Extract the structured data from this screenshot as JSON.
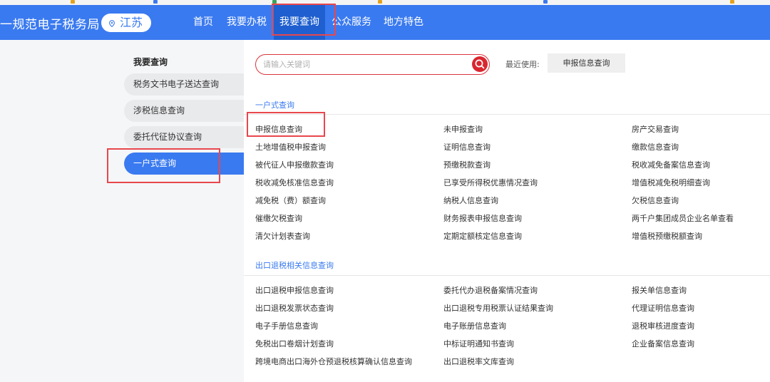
{
  "colors": {
    "primary": "#3a7af0",
    "highlight": "#e8474d",
    "search_button": "#d9262f"
  },
  "header": {
    "brand": "一规范电子税务局",
    "region": "江苏",
    "region_icon": "location-pin-icon",
    "nav": [
      {
        "label": "首页"
      },
      {
        "label": "我要办税"
      },
      {
        "label": "我要查询"
      },
      {
        "label": "公众服务"
      },
      {
        "label": "地方特色"
      }
    ]
  },
  "sidebar": {
    "title": "我要查询",
    "items": [
      {
        "label": "税务文书电子送达查询"
      },
      {
        "label": "涉税信息查询"
      },
      {
        "label": "委托代征协议查询"
      },
      {
        "label": "一户式查询"
      }
    ]
  },
  "search": {
    "placeholder": "请输入关键词",
    "icon": "search-icon"
  },
  "recent": {
    "label": "最近使用:",
    "tag": "申报信息查询"
  },
  "sections": [
    {
      "title": "一户式查询",
      "columns": [
        [
          "申报信息查询",
          "土地增值税申报查询",
          "被代征人申报缴款查询",
          "税收减免核准信息查询",
          "减免税（费）额查询",
          "催缴欠税查询",
          "清欠计划表查询"
        ],
        [
          "未申报查询",
          "证明信息查询",
          "预缴税款查询",
          "已享受所得税优惠情况查询",
          "纳税人信息查询",
          "财务报表申报信息查询",
          "定期定额核定信息查询"
        ],
        [
          "房产交易查询",
          "缴款信息查询",
          "税收减免备案信息查询",
          "增值税减免税明细查询",
          "欠税信息查询",
          "两千户集团成员企业名单查看",
          "增值税预缴税额查询"
        ]
      ]
    },
    {
      "title": "出口退税相关信息查询",
      "columns": [
        [
          "出口退税申报信息查询",
          "出口退税发票状态查询",
          "电子手册信息查询",
          "免税出口卷烟计划查询",
          "跨境电商出口海外仓预退税核算确认信息查询"
        ],
        [
          "委托代办退税备案情况查询",
          "出口退税专用税票认证结果查询",
          "电子账册信息查询",
          "中标证明通知书查询",
          "出口退税率文库查询"
        ],
        [
          "报关单信息查询",
          "代理证明信息查询",
          "退税审核进度查询",
          "企业备案信息查询"
        ]
      ]
    }
  ]
}
